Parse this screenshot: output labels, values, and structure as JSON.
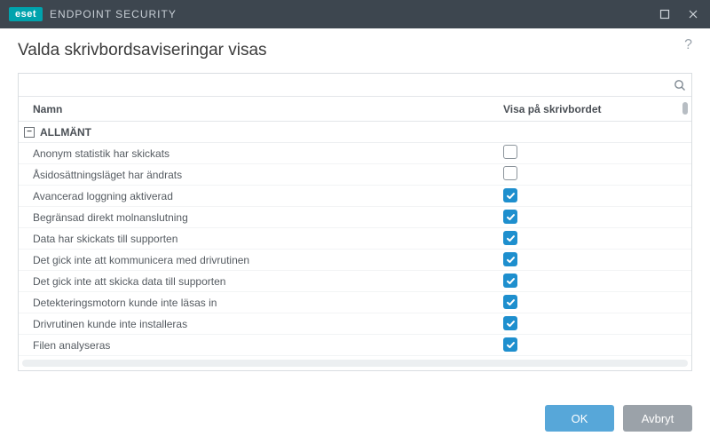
{
  "titlebar": {
    "brand_badge": "eset",
    "brand_text": "ENDPOINT SECURITY"
  },
  "page": {
    "title": "Valda skrivbordsaviseringar visas"
  },
  "search": {
    "placeholder": ""
  },
  "columns": {
    "name": "Namn",
    "show": "Visa på skrivbordet"
  },
  "group": {
    "label": "ALLMÄNT"
  },
  "rows": [
    {
      "name": "Anonym statistik har skickats",
      "checked": false
    },
    {
      "name": "Åsidosättningsläget har ändrats",
      "checked": false
    },
    {
      "name": "Avancerad loggning aktiverad",
      "checked": true
    },
    {
      "name": "Begränsad direkt molnanslutning",
      "checked": true
    },
    {
      "name": "Data har skickats till supporten",
      "checked": true
    },
    {
      "name": "Det gick inte att kommunicera med drivrutinen",
      "checked": true
    },
    {
      "name": "Det gick inte att skicka data till supporten",
      "checked": true
    },
    {
      "name": "Detekteringsmotorn kunde inte läsas in",
      "checked": true
    },
    {
      "name": "Drivrutinen kunde inte installeras",
      "checked": true
    },
    {
      "name": "Filen analyseras",
      "checked": true
    }
  ],
  "footer": {
    "ok": "OK",
    "cancel": "Avbryt"
  }
}
